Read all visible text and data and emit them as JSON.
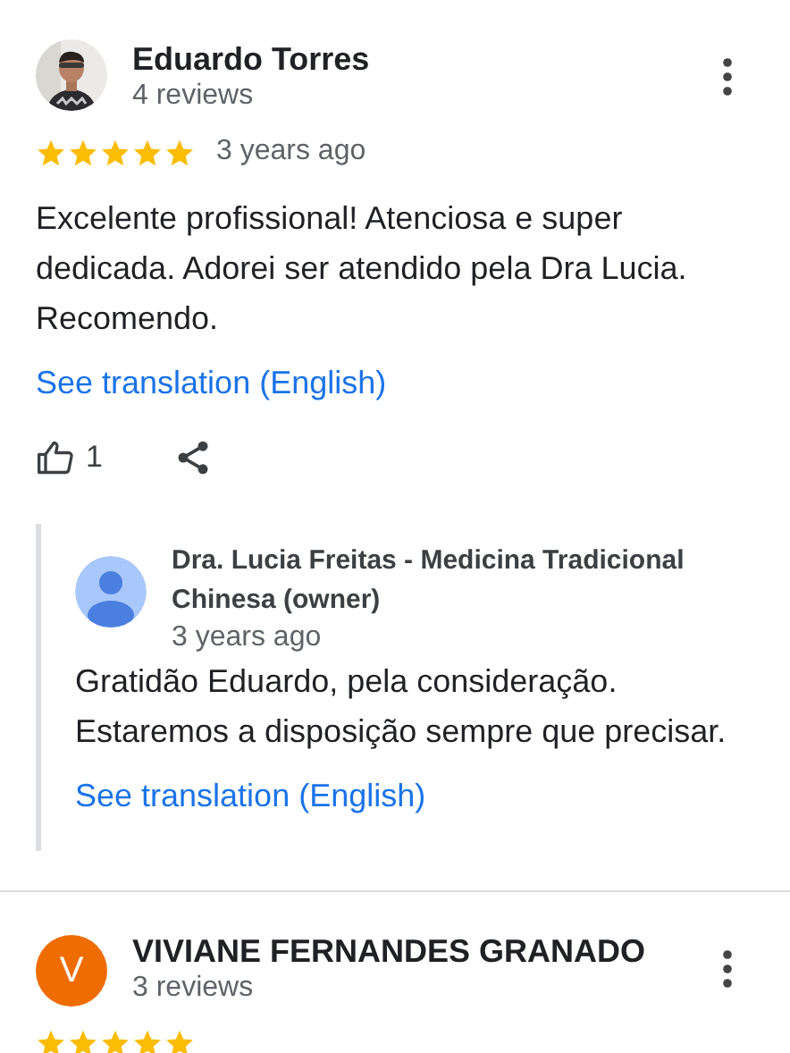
{
  "reviews": [
    {
      "name": "Eduardo Torres",
      "review_count": "4 reviews",
      "stars": 5,
      "time": "3 years ago",
      "text": "Excelente profissional! Atenciosa e super dedicada. Adorei ser atendido pela Dra Lucia. Recomendo.",
      "translation_link": "See translation (English)",
      "likes": "1",
      "owner_reply": {
        "name": "Dra. Lucia Freitas - Medicina Tradicional Chinesa (owner)",
        "time": "3 years ago",
        "text": "Gratidão Eduardo, pela consideração. Estaremos a disposição sempre que precisar.",
        "translation_link": "See translation (English)"
      }
    },
    {
      "avatar": {
        "kind": "letter",
        "letter": "V",
        "color": "#ef6c00"
      },
      "name": "VIVIANE FERNANDES GRANADO",
      "review_count": "3 reviews",
      "stars": 5
    }
  ]
}
